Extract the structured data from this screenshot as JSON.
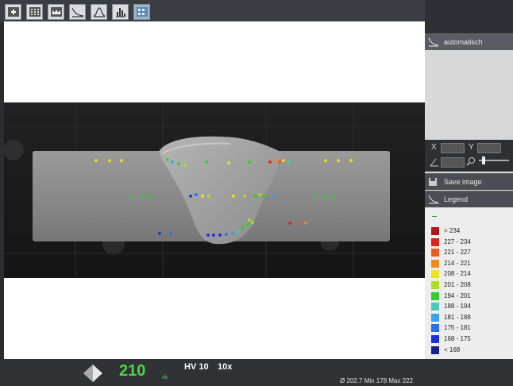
{
  "toolbar": {
    "buttons": [
      {
        "name": "single-point-tool-button",
        "icon": "plus-box-icon"
      },
      {
        "name": "grid-tool-button",
        "icon": "grid-icon"
      },
      {
        "name": "profile-tool-button",
        "icon": "wave-icon"
      },
      {
        "name": "decline-curve-button",
        "icon": "curve-down-icon"
      },
      {
        "name": "bell-curve-button",
        "icon": "bell-curve-icon"
      },
      {
        "name": "histogram-button",
        "icon": "histogram-icon"
      },
      {
        "name": "hardness-map-button",
        "icon": "map-grid-icon"
      }
    ]
  },
  "side_panel": {
    "auto_label": "automatisch",
    "x_label": "X",
    "y_label": "Y",
    "save_image_label": "Save image",
    "legend_label": "Legend"
  },
  "legend": {
    "items": [
      {
        "range": "> 234",
        "color": "#b01818"
      },
      {
        "range": "227 - 234",
        "color": "#e02020"
      },
      {
        "range": "221 - 227",
        "color": "#ee5a1c"
      },
      {
        "range": "214 - 221",
        "color": "#f08a1c"
      },
      {
        "range": "208 - 214",
        "color": "#f2e21a"
      },
      {
        "range": "201 - 208",
        "color": "#a8e21a"
      },
      {
        "range": "194 - 201",
        "color": "#2ecf2e"
      },
      {
        "range": "188 - 194",
        "color": "#4ec8b8"
      },
      {
        "range": "181 - 188",
        "color": "#3aa2e8"
      },
      {
        "range": "175 - 181",
        "color": "#2a6ee8"
      },
      {
        "range": "168 - 175",
        "color": "#1a2ee0"
      },
      {
        "range": "< 168",
        "color": "#1a2290"
      }
    ]
  },
  "status": {
    "value": "210",
    "ok_label": "ok",
    "method": "HV 10",
    "magnification": "10x",
    "stats": "Ø 202.7 Min 178 Max 222"
  }
}
